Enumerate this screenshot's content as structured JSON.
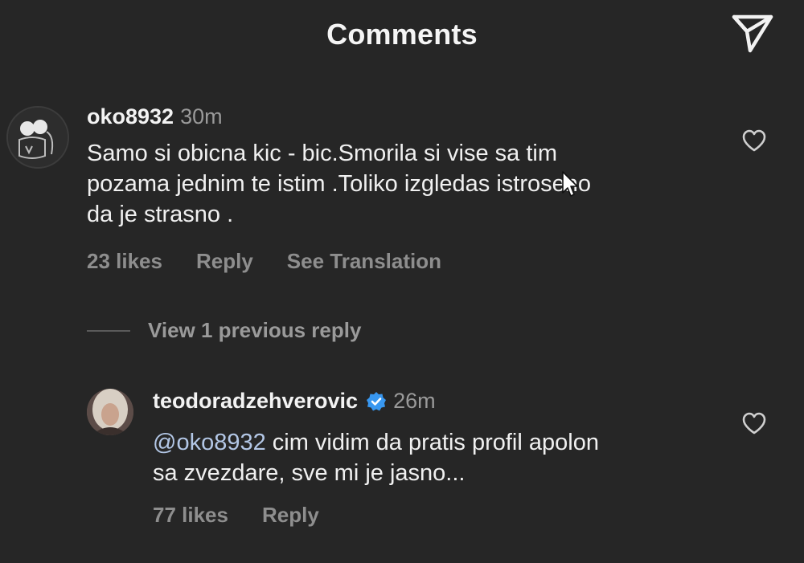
{
  "header": {
    "title": "Comments",
    "send_icon": "send-icon"
  },
  "comments": [
    {
      "username": "oko8932",
      "time": "30m",
      "text": "Samo si obicna kic - bic.Smorila si vise sa tim\npozama jednim te istim .Toliko izgledas istroseno\nda je strasno .",
      "likes": "23 likes",
      "reply_label": "Reply",
      "translate_label": "See Translation"
    }
  ],
  "view_replies": {
    "label": "View 1 previous reply"
  },
  "replies": [
    {
      "username": "teodoradzehverovic",
      "verified": true,
      "time": "26m",
      "mention": "@oko8932",
      "text": " cim vidim da pratis profil apolon\nsa zvezdare, sve mi je jasno...",
      "likes": "77 likes",
      "reply_label": "Reply"
    }
  ],
  "colors": {
    "background": "#262626",
    "verified_badge": "#3897f0",
    "mention": "#b3c7e6",
    "muted": "#8e8e8e"
  }
}
